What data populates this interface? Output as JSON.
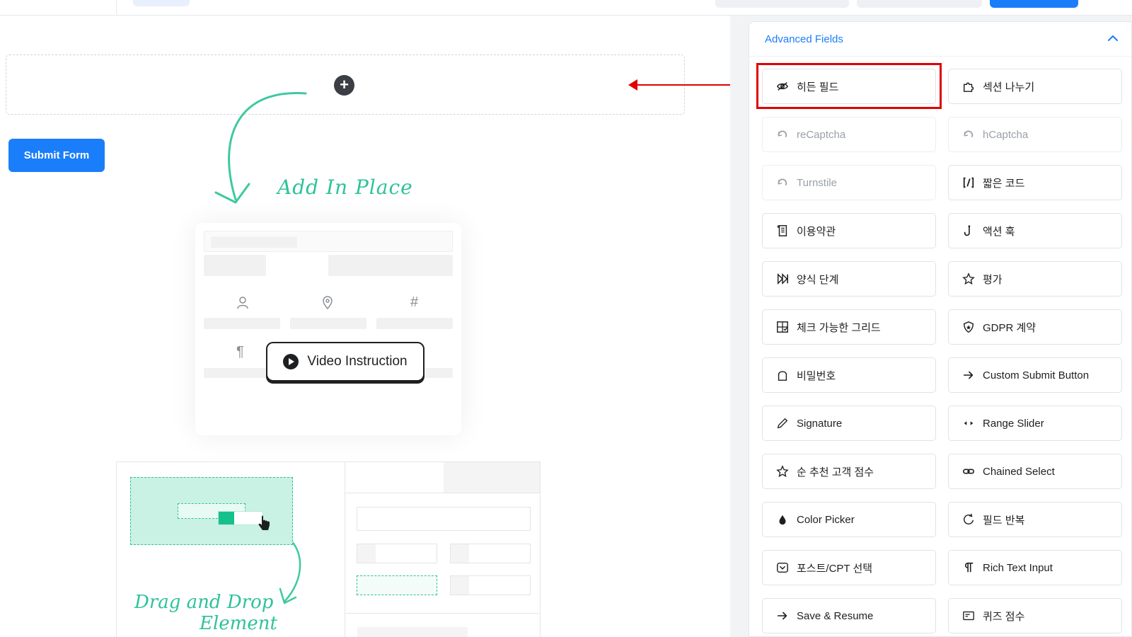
{
  "canvas": {
    "submit_label": "Submit Form",
    "add_in_place": "Add In Place",
    "video_label": "Video Instruction",
    "dnd_line1": "Drag and Drop",
    "dnd_line2": "Element"
  },
  "panel": {
    "title": "Advanced Fields",
    "fields": [
      {
        "label": "히든 필드",
        "icon": "eye-slash-icon",
        "enabled": true
      },
      {
        "label": "섹션 나누기",
        "icon": "puzzle-icon",
        "enabled": true
      },
      {
        "label": "reCaptcha",
        "icon": "recaptcha-icon",
        "enabled": false
      },
      {
        "label": "hCaptcha",
        "icon": "hcaptcha-icon",
        "enabled": false
      },
      {
        "label": "Turnstile",
        "icon": "turnstile-icon",
        "enabled": false
      },
      {
        "label": "짧은 코드",
        "icon": "shortcode-icon",
        "enabled": true
      },
      {
        "label": "이용약관",
        "icon": "scroll-icon",
        "enabled": true
      },
      {
        "label": "액션 훅",
        "icon": "hook-icon",
        "enabled": true
      },
      {
        "label": "양식 단계",
        "icon": "step-forward-icon",
        "enabled": true
      },
      {
        "label": "평가",
        "icon": "star-icon",
        "enabled": true
      },
      {
        "label": "체크 가능한 그리드",
        "icon": "grid-check-icon",
        "enabled": true
      },
      {
        "label": "GDPR 계약",
        "icon": "shield-icon",
        "enabled": true
      },
      {
        "label": "비밀번호",
        "icon": "lock-icon",
        "enabled": true
      },
      {
        "label": "Custom Submit Button",
        "icon": "arrow-right-icon",
        "enabled": true
      },
      {
        "label": "Signature",
        "icon": "pen-icon",
        "enabled": true
      },
      {
        "label": "Range Slider",
        "icon": "range-icon",
        "enabled": true
      },
      {
        "label": "순 추천 고객 점수",
        "icon": "star-outline-icon",
        "enabled": true
      },
      {
        "label": "Chained Select",
        "icon": "link-icon",
        "enabled": true
      },
      {
        "label": "Color Picker",
        "icon": "droplet-icon",
        "enabled": true
      },
      {
        "label": "필드 반복",
        "icon": "repeat-icon",
        "enabled": true
      },
      {
        "label": "포스트/CPT 선택",
        "icon": "post-select-icon",
        "enabled": true
      },
      {
        "label": "Rich Text Input",
        "icon": "paragraph-icon",
        "enabled": true
      },
      {
        "label": "Save & Resume",
        "icon": "save-arrow-icon",
        "enabled": true
      },
      {
        "label": "퀴즈 점수",
        "icon": "quiz-icon",
        "enabled": true
      }
    ]
  },
  "colors": {
    "primary": "#1a7efb",
    "accent_green": "#2ec29a",
    "highlight_red": "#e00000"
  }
}
